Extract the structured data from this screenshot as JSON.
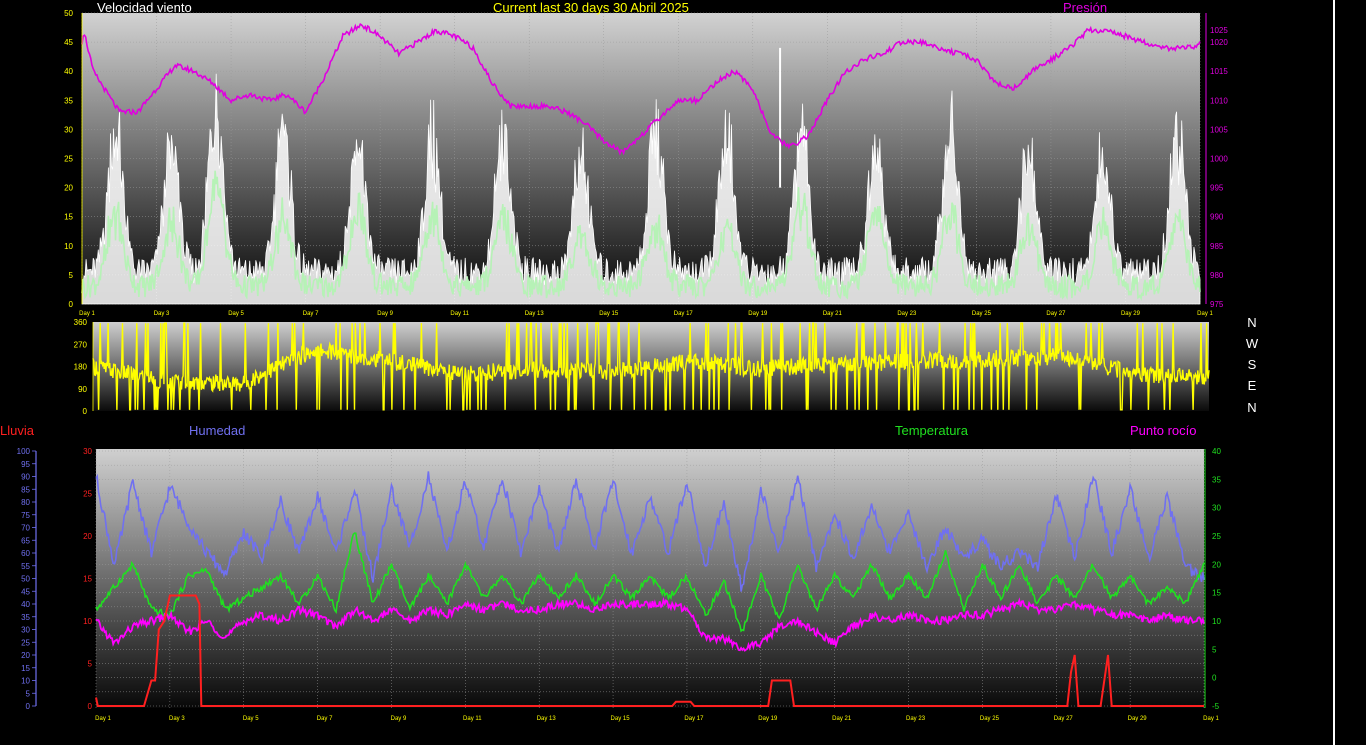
{
  "colors": {
    "wind": "#ffffff",
    "gust": "#b6f2b6",
    "pressure": "#e000e0",
    "direction": "#ffff00",
    "humidity": "#7070f0",
    "temperature": "#20e020",
    "dewpoint": "#ff00ff",
    "rain": "#ff2020",
    "tick": "#ffff00"
  },
  "header": {
    "wind_title": "Velocidad viento",
    "period_title": "Current last 30 days 30 Abril 2025",
    "pressure_title": "Presión"
  },
  "compass": [
    "N",
    "W",
    "S",
    "E",
    "N"
  ],
  "legend": {
    "rain": "Lluvia",
    "humidity": "Humedad",
    "temperature": "Temperatura",
    "dewpoint": "Punto rocío"
  },
  "chart_data": [
    {
      "type": "line",
      "title": "Velocidad viento",
      "x_ticks": [
        "Day 1",
        "Day 3",
        "Day 5",
        "Day 7",
        "Day 9",
        "Day 11",
        "Day 13",
        "Day 15",
        "Day 17",
        "Day 19",
        "Day 21",
        "Day 23",
        "Day 25",
        "Day 27",
        "Day 29",
        "Day 1"
      ],
      "y_left": {
        "min": 0,
        "max": 50,
        "ticks": [
          0,
          5,
          10,
          15,
          20,
          25,
          30,
          35,
          40,
          45,
          50
        ]
      },
      "y_right": {
        "label": "Presión",
        "min": 975,
        "max": 1025,
        "ticks": [
          975,
          980,
          985,
          990,
          995,
          1000,
          1005,
          1010,
          1015,
          1020,
          1025
        ]
      },
      "grid": true,
      "series": [
        {
          "key": "pressure",
          "axis": "right",
          "x": [
            0,
            0.05,
            0.3,
            1.0,
            1.5,
            2.0,
            2.5,
            3.0,
            3.5,
            4.0,
            4.5,
            5.0,
            5.5,
            6.0,
            6.5,
            7.0,
            7.5,
            8.0,
            8.5,
            9.0,
            9.5,
            10.0,
            10.5,
            11.0,
            11.5,
            12.0,
            12.5,
            13.0,
            13.5,
            14.0,
            14.5,
            15.0,
            15.5,
            16.0,
            16.5,
            17.0,
            17.5,
            18.0,
            18.5,
            19.0,
            19.5,
            20.0,
            20.5,
            21.0,
            21.5,
            22.0,
            22.5,
            23.0,
            23.5,
            24.0,
            24.5,
            25.0,
            25.5,
            26.0,
            26.5,
            27.0,
            27.5,
            28.0,
            28.5,
            29.0,
            29.5,
            29.9,
            30.0
          ],
          "y": [
            1020,
            1022,
            1015,
            1008,
            1008,
            1012,
            1016,
            1015,
            1013,
            1010,
            1011,
            1010,
            1011,
            1008,
            1014,
            1021,
            1023,
            1021,
            1018,
            1020,
            1022,
            1021,
            1019,
            1013,
            1009,
            1009,
            1009,
            1008,
            1006,
            1003,
            1001,
            1004,
            1007,
            1010,
            1010,
            1013,
            1015,
            1012,
            1004,
            1002,
            1004,
            1010,
            1015,
            1017,
            1018,
            1020,
            1020,
            1019,
            1018,
            1017,
            1013,
            1012,
            1015,
            1017,
            1019,
            1022,
            1022,
            1021,
            1020,
            1019,
            1019,
            1019,
            1020
          ]
        },
        {
          "key": "gust",
          "axis": "left",
          "peak_days": [
            0.9,
            2.4,
            3.6,
            5.4,
            7.4,
            9.4,
            11.3,
            13.4,
            15.4,
            17.3,
            19.3,
            21.3,
            23.3,
            25.4,
            27.4,
            29.4
          ],
          "peak_values": [
            31,
            28,
            38,
            30,
            30,
            29,
            29,
            27,
            31,
            30,
            30,
            30,
            31,
            28,
            26,
            30
          ]
        },
        {
          "key": "wind",
          "axis": "left",
          "peak_days": [
            0.9,
            2.4,
            3.6,
            5.4,
            7.4,
            9.4,
            11.3,
            13.4,
            15.4,
            17.3,
            19.3,
            21.3,
            23.3,
            25.4,
            27.4,
            29.4
          ],
          "peak_values": [
            15,
            13,
            20,
            14,
            17,
            15,
            14,
            12,
            13,
            12,
            18,
            16,
            16,
            13,
            12,
            14
          ]
        }
      ]
    },
    {
      "type": "line",
      "title": "",
      "y_left": {
        "min": 0,
        "max": 360,
        "ticks": [
          0,
          90,
          180,
          270,
          360
        ]
      },
      "series": [
        {
          "key": "direction",
          "axis": "left",
          "x": [
            0,
            2,
            4,
            6,
            8,
            10,
            12,
            14,
            16,
            18,
            20,
            22,
            24,
            26,
            28,
            30
          ],
          "y": [
            180,
            120,
            110,
            250,
            200,
            150,
            170,
            160,
            200,
            170,
            190,
            200,
            210,
            220,
            150,
            140
          ]
        }
      ]
    },
    {
      "type": "line",
      "title": "",
      "x_ticks": [
        "Day 1",
        "Day 3",
        "Day 5",
        "Day 7",
        "Day 9",
        "Day 11",
        "Day 13",
        "Day 15",
        "Day 17",
        "Day 19",
        "Day 21",
        "Day 23",
        "Day 25",
        "Day 27",
        "Day 29",
        "Day 1"
      ],
      "y_left": {
        "label": "Humedad",
        "min": 0,
        "max": 100,
        "ticks": [
          0,
          5,
          10,
          15,
          20,
          25,
          30,
          35,
          40,
          45,
          50,
          55,
          60,
          65,
          70,
          75,
          80,
          85,
          90,
          95,
          100
        ]
      },
      "y_rain": {
        "label": "Lluvia",
        "min": 0,
        "max": 30,
        "ticks": [
          0,
          5,
          10,
          15,
          20,
          25,
          30
        ]
      },
      "y_right": {
        "label": "Temperatura",
        "min": -5,
        "max": 40,
        "ticks": [
          -5,
          0,
          5,
          10,
          15,
          20,
          25,
          30,
          35,
          40
        ]
      },
      "grid": true,
      "series": [
        {
          "key": "humidity",
          "axis": "left",
          "x": [
            0,
            0.5,
            1,
            1.5,
            2,
            2.5,
            3,
            3.5,
            4,
            4.5,
            5,
            5.5,
            6,
            6.5,
            7,
            7.5,
            8,
            8.5,
            9,
            9.5,
            10,
            10.5,
            11,
            11.5,
            12,
            12.5,
            13,
            13.5,
            14,
            14.5,
            15,
            15.5,
            16,
            16.5,
            17,
            17.5,
            18,
            18.5,
            19,
            19.5,
            20,
            20.5,
            21,
            21.5,
            22,
            22.5,
            23,
            23.5,
            24,
            24.5,
            25,
            25.5,
            26,
            26.5,
            27,
            27.5,
            28,
            28.5,
            29,
            29.5,
            30
          ],
          "y": [
            90,
            55,
            88,
            60,
            86,
            72,
            60,
            52,
            68,
            58,
            80,
            60,
            82,
            60,
            85,
            50,
            85,
            62,
            90,
            60,
            88,
            62,
            90,
            60,
            85,
            60,
            88,
            62,
            88,
            60,
            82,
            60,
            88,
            55,
            80,
            45,
            85,
            60,
            90,
            55,
            75,
            58,
            78,
            60,
            75,
            55,
            70,
            58,
            65,
            55,
            60,
            55,
            82,
            58,
            90,
            60,
            85,
            58,
            82,
            55,
            50
          ]
        },
        {
          "key": "temperature",
          "axis": "right",
          "x": [
            0,
            0.5,
            1,
            1.5,
            2,
            2.5,
            3,
            3.5,
            4,
            4.5,
            5,
            5.5,
            6,
            6.5,
            7,
            7.5,
            8,
            8.5,
            9,
            9.5,
            10,
            10.5,
            11,
            11.5,
            12,
            12.5,
            13,
            13.5,
            14,
            14.5,
            15,
            15.5,
            16,
            16.5,
            17,
            17.5,
            18,
            18.5,
            19,
            19.5,
            20,
            20.5,
            21,
            21.5,
            22,
            22.5,
            23,
            23.5,
            24,
            24.5,
            25,
            25.5,
            26,
            26.5,
            27,
            27.5,
            28,
            28.5,
            29,
            29.5,
            30
          ],
          "y": [
            12,
            16,
            20,
            12,
            11,
            18,
            19,
            12,
            14,
            16,
            18,
            13,
            18,
            12,
            26,
            13,
            20,
            12,
            18,
            13,
            20,
            14,
            18,
            13,
            18,
            14,
            18,
            13,
            18,
            14,
            18,
            14,
            18,
            11,
            17,
            8,
            18,
            10,
            20,
            12,
            18,
            14,
            20,
            14,
            18,
            14,
            22,
            12,
            20,
            14,
            20,
            13,
            18,
            14,
            20,
            14,
            18,
            13,
            16,
            13,
            20
          ]
        },
        {
          "key": "dewpoint",
          "axis": "right",
          "x": [
            0,
            0.5,
            1,
            1.5,
            2,
            2.5,
            3,
            3.5,
            4,
            4.5,
            5,
            5.5,
            6,
            6.5,
            7,
            7.5,
            8,
            8.5,
            9,
            9.5,
            10,
            10.5,
            11,
            11.5,
            12,
            12.5,
            13,
            13.5,
            14,
            14.5,
            15,
            15.5,
            16,
            16.5,
            17,
            17.5,
            18,
            18.5,
            19,
            19.5,
            20,
            20.5,
            21,
            21.5,
            22,
            22.5,
            23,
            23.5,
            24,
            24.5,
            25,
            25.5,
            26,
            26.5,
            27,
            27.5,
            28,
            28.5,
            29,
            29.5,
            30
          ],
          "y": [
            10,
            6,
            9,
            10,
            11,
            8,
            10,
            7,
            10,
            11,
            10,
            12,
            11,
            9,
            12,
            10,
            12,
            10,
            12,
            11,
            13,
            12,
            13,
            12,
            12,
            13,
            13,
            12,
            13,
            13,
            13,
            13,
            12,
            7,
            7,
            5,
            6,
            9,
            10,
            8,
            6,
            9,
            11,
            10,
            11,
            10,
            10,
            11,
            11,
            12,
            13,
            12,
            12,
            13,
            12,
            11,
            11,
            10,
            11,
            10,
            10
          ]
        },
        {
          "key": "rain",
          "axis": "rain",
          "x": [
            0,
            0.05,
            0.15,
            1.3,
            1.5,
            1.6,
            1.7,
            1.85,
            2.0,
            2.6,
            2.7,
            2.8,
            2.85,
            15.6,
            15.7,
            16.1,
            16.2,
            18.2,
            18.3,
            18.8,
            18.9,
            26.3,
            26.4,
            26.5,
            26.6,
            27.2,
            27.3,
            27.4,
            27.5,
            30
          ],
          "y": [
            1,
            0,
            0,
            0,
            3,
            3,
            9,
            10,
            13,
            13,
            13,
            12,
            0,
            0,
            0.5,
            0.5,
            0,
            0,
            3,
            3,
            0,
            0,
            4,
            6,
            0,
            0,
            3,
            6,
            0,
            0
          ]
        }
      ]
    }
  ]
}
